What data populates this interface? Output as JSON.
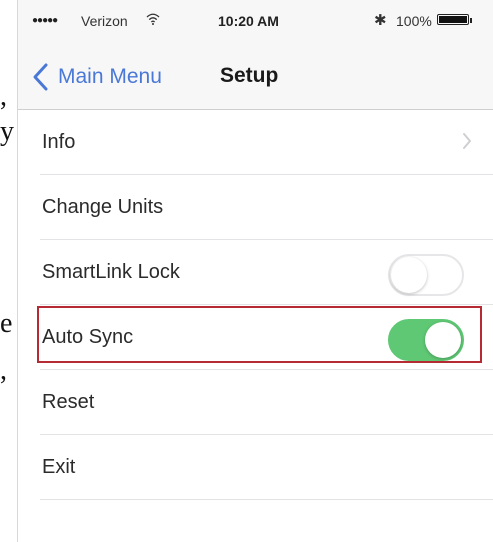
{
  "fragments": [
    ",",
    "y",
    "e",
    ","
  ],
  "status_bar": {
    "signal_dots": "●●●●●",
    "carrier": "Verizon",
    "time": "10:20 AM",
    "battery_percent": "100%",
    "icons": [
      "signal-dots-icon",
      "wifi-icon",
      "bluetooth-icon",
      "battery-icon"
    ]
  },
  "nav": {
    "back_label": "Main Menu",
    "title": "Setup",
    "accent_color": "#4a78d6"
  },
  "menu": {
    "items": [
      {
        "label": "Info",
        "accessory": "chevron-right-icon"
      },
      {
        "label": "Change Units"
      },
      {
        "label": "SmartLink Lock",
        "toggle": "off"
      },
      {
        "label": "Auto Sync",
        "toggle": "on",
        "highlighted": true
      },
      {
        "label": "Reset"
      },
      {
        "label": "Exit"
      }
    ]
  },
  "colors": {
    "toggle_on": "#5fc874",
    "highlight_border": "#b62a33"
  }
}
